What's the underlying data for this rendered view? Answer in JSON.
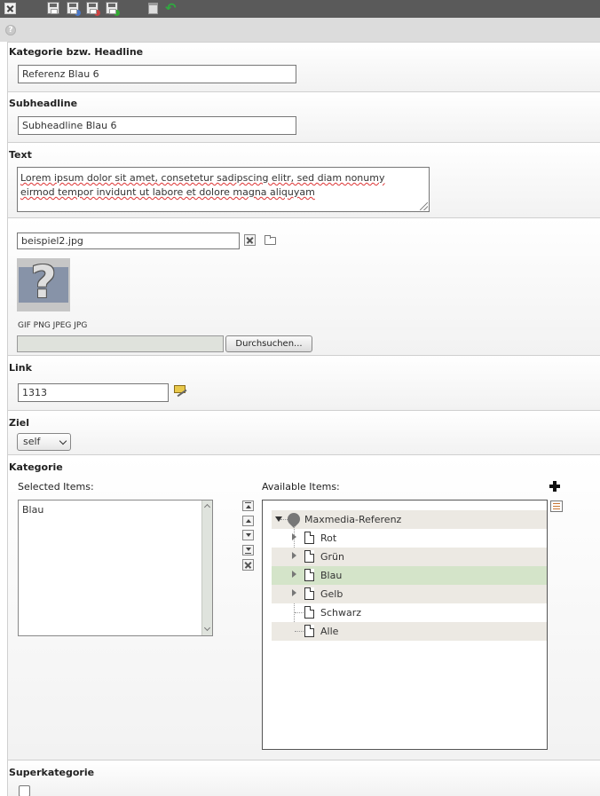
{
  "toolbar": {
    "icons": [
      "close-icon",
      "save-icon",
      "save-view-icon",
      "save-close-icon",
      "save-new-icon",
      "delete-icon",
      "undo-icon"
    ]
  },
  "fields": {
    "headline": {
      "label": "Kategorie bzw. Headline",
      "value": "Referenz Blau 6"
    },
    "subheadline": {
      "label": "Subheadline",
      "value": "Subheadline Blau 6"
    },
    "text": {
      "label": "Text",
      "line1": "Lorem ipsum dolor sit amet, consetetur sadipscing elitr, sed diam nonumy",
      "line2": "eirmod tempor invidunt ut labore et dolore magna aliquyam"
    },
    "image": {
      "filename": "beispiel2.jpg",
      "filetypes": "GIF PNG JPEG JPG",
      "browse_label": "Durchsuchen..."
    },
    "link": {
      "label": "Link",
      "value": "1313"
    },
    "target": {
      "label": "Ziel",
      "value": "self"
    },
    "category": {
      "label": "Kategorie",
      "selected_label": "Selected Items:",
      "available_label": "Available Items:",
      "selected_items": [
        "Blau"
      ],
      "tree": {
        "root": "Maxmedia-Referenz",
        "items": [
          "Rot",
          "Grün",
          "Blau",
          "Gelb",
          "Schwarz",
          "Alle"
        ]
      }
    },
    "supercategory": {
      "label": "Superkategorie",
      "checked": false
    }
  },
  "colors": {
    "toolbar": "#5a5a5a",
    "tree_selected": "#d4e4c9",
    "tree_alt": "#ece9e3"
  }
}
